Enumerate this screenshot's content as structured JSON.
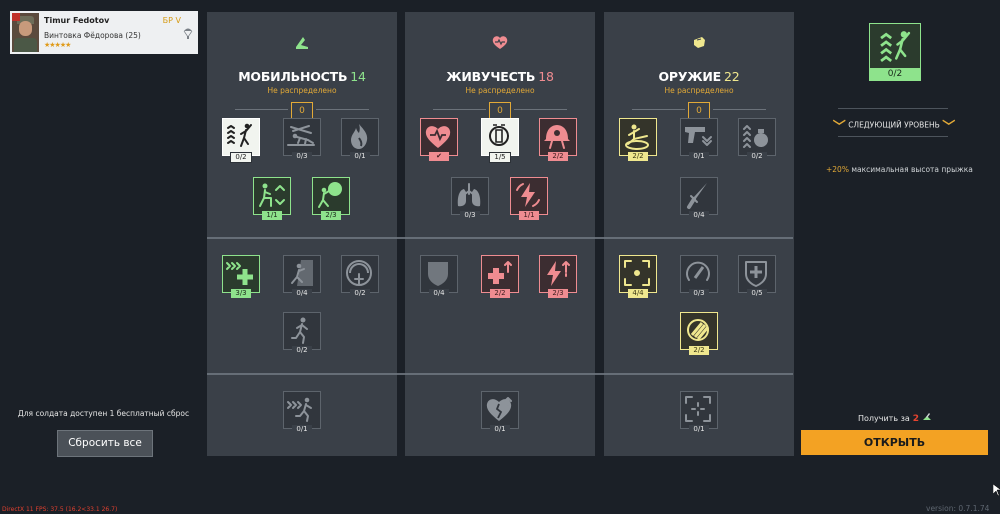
{
  "soldier": {
    "name": "Timur Fedotov",
    "weapon": "Винтовка Фёдорова (25)",
    "stars": "★★★★★",
    "rank": "БР V",
    "stars_icon": "rating-stars",
    "class_icon": "paratrooper-icon"
  },
  "columns": [
    {
      "id": "mobility",
      "icon": "boot-icon",
      "icon_color": "#8ee38c",
      "title": "МОБИЛЬНОСТЬ",
      "points": "14",
      "points_color": "#8ee38c",
      "unassigned_label": "Не распределено",
      "unassigned_value": "0",
      "skills": [
        {
          "name": "jump-height",
          "icon": "jump-icon",
          "count": "0/2",
          "state": "active",
          "tier": 0,
          "slot": 0
        },
        {
          "name": "crawl-speed",
          "icon": "crawl-icon",
          "count": "0/3",
          "state": "locked",
          "tier": 0,
          "slot": 1
        },
        {
          "name": "fire-resist",
          "icon": "flame-icon",
          "count": "0/1",
          "state": "locked",
          "tier": 0,
          "slot": 2
        },
        {
          "name": "crouch-speed",
          "icon": "crouch-icon",
          "count": "1/1",
          "state": "green",
          "tier": 0,
          "slot": 3
        },
        {
          "name": "stamina",
          "icon": "breath-icon",
          "count": "2/3",
          "state": "green",
          "tier": 0,
          "slot": 4
        },
        {
          "name": "sprint-heal",
          "icon": "sprint-heal-icon",
          "count": "3/3",
          "state": "green",
          "tier": 1,
          "slot": 0
        },
        {
          "name": "climb",
          "icon": "climb-icon",
          "count": "0/4",
          "state": "locked",
          "tier": 1,
          "slot": 1
        },
        {
          "name": "parachute",
          "icon": "parachute-icon",
          "count": "0/2",
          "state": "locked",
          "tier": 1,
          "slot": 2
        },
        {
          "name": "run-speed",
          "icon": "run-icon",
          "count": "0/2",
          "state": "locked",
          "tier": 1,
          "slot": 3
        },
        {
          "name": "dash",
          "icon": "dash-icon",
          "count": "0/1",
          "state": "locked",
          "tier": 2,
          "slot": 0
        }
      ]
    },
    {
      "id": "vitality",
      "icon": "heart-icon",
      "icon_color": "#ef8c91",
      "title": "ЖИВУЧЕСТЬ",
      "points": "18",
      "points_color": "#ef8c91",
      "unassigned_label": "Не распределено",
      "unassigned_value": "0",
      "skills": [
        {
          "name": "max-health",
          "icon": "heart-check-icon",
          "count": "✔",
          "state": "red",
          "tier": 0,
          "slot": 0
        },
        {
          "name": "bandolier",
          "icon": "ammo-belt-icon",
          "count": "1/5",
          "state": "active",
          "tier": 0,
          "slot": 1
        },
        {
          "name": "helmet",
          "icon": "helmet-icon",
          "count": "2/2",
          "state": "red",
          "tier": 0,
          "slot": 2
        },
        {
          "name": "lungs",
          "icon": "lungs-icon",
          "count": "0/3",
          "state": "locked",
          "tier": 0,
          "slot": 3
        },
        {
          "name": "shock-resist",
          "icon": "bolt-cycle-icon",
          "count": "1/1",
          "state": "red",
          "tier": 0,
          "slot": 4
        },
        {
          "name": "armor",
          "icon": "shield-icon",
          "count": "0/4",
          "state": "locked",
          "tier": 1,
          "slot": 0
        },
        {
          "name": "healing-boost",
          "icon": "health-plus-icon",
          "count": "2/2",
          "state": "red",
          "tier": 1,
          "slot": 1
        },
        {
          "name": "energy-boost",
          "icon": "bolt-up-icon",
          "count": "2/3",
          "state": "red",
          "tier": 1,
          "slot": 2
        },
        {
          "name": "last-stand",
          "icon": "broken-heart-icon",
          "count": "0/1",
          "state": "locked",
          "tier": 2,
          "slot": 0
        }
      ]
    },
    {
      "id": "weapons",
      "icon": "fist-icon",
      "icon_color": "#efe78e",
      "title": "ОРУЖИЕ",
      "points": "22",
      "points_color": "#efe78e",
      "unassigned_label": "Не распределено",
      "unassigned_value": "0",
      "skills": [
        {
          "name": "melee-kick",
          "icon": "kick-icon",
          "count": "2/2",
          "state": "yellow",
          "tier": 0,
          "slot": 0
        },
        {
          "name": "pistol-swap",
          "icon": "pistol-icon",
          "count": "0/1",
          "state": "locked",
          "tier": 0,
          "slot": 1
        },
        {
          "name": "grenade-carry",
          "icon": "grenade-icon",
          "count": "0/2",
          "state": "locked",
          "tier": 0,
          "slot": 2
        },
        {
          "name": "bayonet",
          "icon": "knife-icon",
          "count": "0/4",
          "state": "locked",
          "tier": 0,
          "slot": 4
        },
        {
          "name": "aim-focus",
          "icon": "crosshair-icon",
          "count": "4/4",
          "state": "yellow",
          "tier": 1,
          "slot": 0
        },
        {
          "name": "reload-speed",
          "icon": "reload-icon",
          "count": "0/3",
          "state": "locked",
          "tier": 1,
          "slot": 1
        },
        {
          "name": "medic-crate",
          "icon": "medkit-icon",
          "count": "0/5",
          "state": "locked",
          "tier": 1,
          "slot": 2
        },
        {
          "name": "ammo-pouch",
          "icon": "bullets-icon",
          "count": "2/2",
          "state": "yellow",
          "tier": 1,
          "slot": 3
        },
        {
          "name": "target-lock",
          "icon": "focus-icon",
          "count": "0/1",
          "state": "locked",
          "tier": 2,
          "slot": 0
        }
      ]
    }
  ],
  "selected": {
    "icon": "jump-icon",
    "count": "0/2",
    "next_level": "СЛЕДУЮЩИЙ УРОВЕНЬ",
    "bonus_pct": "+20%",
    "bonus_text": " максимальная высота прыжка"
  },
  "reset": {
    "note": "Для солдата доступен 1 бесплатный сброс",
    "button": "Сбросить все"
  },
  "unlock": {
    "get_for": "Получить за",
    "cost": "2",
    "button": "ОТКРЫТЬ"
  },
  "debug": {
    "fps": "DirectX 11 FPS: 37.5 (16.2<33.1 26.7)",
    "version": "version: 0.7.1.74"
  }
}
